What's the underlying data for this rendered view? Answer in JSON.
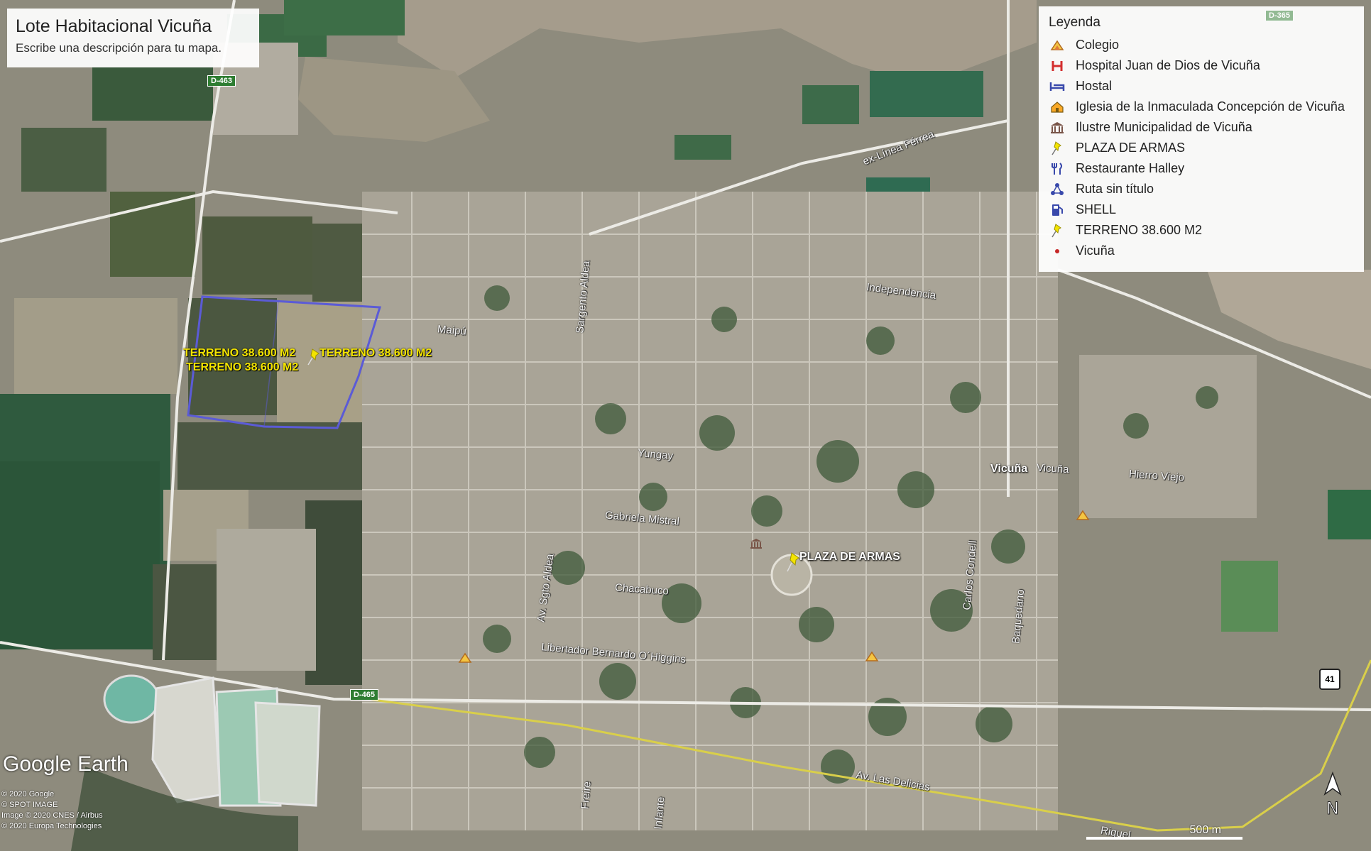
{
  "map": {
    "title": "Lote Habitacional Vicuña",
    "description": "Escribe una descripción para tu mapa."
  },
  "legend": {
    "title": "Leyenda",
    "items": [
      {
        "label": "Colegio",
        "icon": "school-icon",
        "color": "#e07b39"
      },
      {
        "label": "Hospital Juan de Dios de Vicuña",
        "icon": "hospital-icon",
        "color": "#d32f2f"
      },
      {
        "label": "Hostal",
        "icon": "bed-icon",
        "color": "#3949ab"
      },
      {
        "label": "Iglesia de la Inmaculada Concepción de Vicuña",
        "icon": "church-icon",
        "color": "#f9a825"
      },
      {
        "label": "Ilustre Municipalidad de Vicuña",
        "icon": "government-icon",
        "color": "#795548"
      },
      {
        "label": "PLAZA DE ARMAS",
        "icon": "pushpin-icon",
        "color": "#f3e400"
      },
      {
        "label": "Restaurante Halley",
        "icon": "restaurant-icon",
        "color": "#3949ab"
      },
      {
        "label": "Ruta sin título",
        "icon": "route-icon",
        "color": "#3949ab"
      },
      {
        "label": "SHELL",
        "icon": "gas-station-icon",
        "color": "#3949ab"
      },
      {
        "label": "TERRENO 38.600 M2",
        "icon": "pushpin-icon",
        "color": "#f3e400"
      },
      {
        "label": "Vicuña",
        "icon": "dot-icon",
        "color": "#c62828"
      }
    ]
  },
  "placemarks": {
    "terreno_labels": [
      "TERRENO 38.600 M2",
      "TERRENO 38.600 M2",
      "TERRENO 38.600 M2"
    ],
    "plaza": "PLAZA DE ARMAS",
    "vicuna": "Vicuña"
  },
  "streets": {
    "linea_ferrea": "ex-Línea Férrea",
    "independencia": "Independencia",
    "maipu": "Maipú",
    "sargento_aldea": "Sargento Aldea",
    "yungay": "Yungay",
    "vicuna": "Vicuña",
    "hierro_viejo": "Hierro Viejo",
    "gabriela_mistral": "Gabriela Mistral",
    "chacabuco": "Chacabuco",
    "carlos_condell": "Carlos Condell",
    "baquedano": "Baquedano",
    "ohiggins": "Libertador Bernardo O´Higgins",
    "av_sgto_aldea": "Av. Sgto Aldea",
    "av_las_delicias": "Av. Las Delicias",
    "freire": "Freire",
    "infante": "Infante",
    "riquelme": "Riquel"
  },
  "road_signs": {
    "d463": "D-463",
    "d465": "D-465",
    "d365": "D-365",
    "r41": "41"
  },
  "footer": {
    "logo": "Google Earth",
    "credits": [
      "© 2020 Google",
      "© SPOT IMAGE",
      "Image © 2020 CNES / Airbus",
      "© 2020 Europa Technologies"
    ],
    "scale": "500 m",
    "north": "N"
  },
  "colors": {
    "boundary": "#5b5bd6",
    "placemark_label": "#f3e400",
    "route": "#d9cf4a"
  }
}
